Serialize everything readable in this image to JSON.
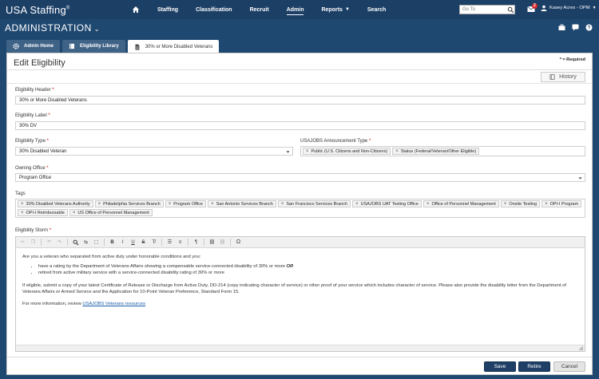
{
  "app": {
    "logo": "USA Staffing",
    "logo_mark": "®"
  },
  "nav": {
    "items": [
      {
        "label": "Staffing"
      },
      {
        "label": "Classification"
      },
      {
        "label": "Recruit"
      },
      {
        "label": "Admin"
      },
      {
        "label": "Reports"
      },
      {
        "label": "Search"
      }
    ],
    "goto_placeholder": "Go To",
    "notification_count": "2",
    "user_name": "Kasey Acres - OPM"
  },
  "header": {
    "title": "ADMINISTRATION"
  },
  "tabs": [
    {
      "label": "Admin Home"
    },
    {
      "label": "Eligibility Library"
    },
    {
      "label": "30% or More Disabled Veterans"
    }
  ],
  "page": {
    "title": "Edit Eligibility",
    "required_note": "* = Required",
    "history_label": "History"
  },
  "form": {
    "header_label": "Eligibility Header",
    "header_value": "30% or More Disabled Veterans",
    "label_label": "Eligibility Label",
    "label_value": "30% DV",
    "type_label": "Eligibility Type",
    "type_value": "30% Disabled Veteran",
    "usajobs_label": "USAJOBS Announcement Type",
    "usajobs_chips": [
      "Public (U.S. Citizens and Non-Citizens)",
      "Status (Federal/Veteran/Other Eligible)"
    ],
    "owning_label": "Owning Office",
    "owning_value": "Program Office",
    "tags_label": "Tags",
    "tags": [
      "30% Disabled Veterans Authority",
      "Philadelphia Services Branch",
      "Program Office",
      "San Antonio Services Branch",
      "San Francisco Services Branch",
      "USAJOBS UAT Testing Office",
      "Office of Personnel Management",
      "Onsite Testing",
      "OPI-I Program",
      "OPI-I Reimbursable",
      "US Office of Personnel Management"
    ],
    "storm_label": "Eligibility Storm",
    "required_mark": "*"
  },
  "editor": {
    "intro": "Are you a veteran who separated from active duty under honorable conditions and you:",
    "bullet1_text": "have a rating by the Department of Veterans Affairs showing a compensable service-connected disability of 30% or more ",
    "bullet1_em": "OR",
    "bullet2": "retired from active military service with a service-connected disability rating of 30% or more",
    "para2": "If eligible, submit a copy of your latest Certificate of Release or Discharge from Active Duty, DD-214 (copy indicating character of service) or other proof of your service which includes character of service. Please also provide the disability letter from the Department of Veterans Affairs or Armed Service and the Application for 10-Point Veteran Preference, Standard Form 15.",
    "more_prefix": "For more information, review ",
    "more_link": "USAJOBS Veterans resources"
  },
  "buttons": {
    "save": "Save",
    "retire": "Retire",
    "cancel": "Cancel"
  }
}
